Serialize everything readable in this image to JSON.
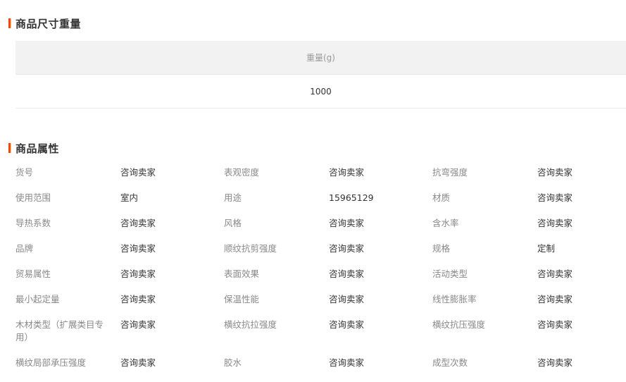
{
  "colors": {
    "accent": "#ff4400",
    "header_bg": "#f2f2f2",
    "label_text": "#888888",
    "value_text": "#333333"
  },
  "size_section": {
    "title": "商品尺寸重量",
    "column_header": "重量(g)",
    "value": "1000"
  },
  "attr_section": {
    "title": "商品属性",
    "rows": [
      [
        {
          "label": "货号",
          "value": "咨询卖家"
        },
        {
          "label": "表观密度",
          "value": "咨询卖家"
        },
        {
          "label": "抗弯强度",
          "value": "咨询卖家"
        }
      ],
      [
        {
          "label": "使用范围",
          "value": "室内"
        },
        {
          "label": "用途",
          "value": "15965129"
        },
        {
          "label": "材质",
          "value": "咨询卖家"
        }
      ],
      [
        {
          "label": "导热系数",
          "value": "咨询卖家"
        },
        {
          "label": "风格",
          "value": "咨询卖家"
        },
        {
          "label": "含水率",
          "value": "咨询卖家"
        }
      ],
      [
        {
          "label": "品牌",
          "value": "咨询卖家"
        },
        {
          "label": "顺纹抗剪强度",
          "value": "咨询卖家"
        },
        {
          "label": "规格",
          "value": "定制"
        }
      ],
      [
        {
          "label": "贸易属性",
          "value": "咨询卖家"
        },
        {
          "label": "表面效果",
          "value": "咨询卖家"
        },
        {
          "label": "活动类型",
          "value": "咨询卖家"
        }
      ],
      [
        {
          "label": "最小起定量",
          "value": "咨询卖家"
        },
        {
          "label": "保温性能",
          "value": "咨询卖家"
        },
        {
          "label": "线性膨胀率",
          "value": "咨询卖家"
        }
      ],
      [
        {
          "label": "木材类型（扩展类目专用）",
          "value": "咨询卖家"
        },
        {
          "label": "横纹抗拉强度",
          "value": "咨询卖家"
        },
        {
          "label": "横纹抗压强度",
          "value": "咨询卖家"
        }
      ],
      [
        {
          "label": "横纹局部承压强度",
          "value": "咨询卖家"
        },
        {
          "label": "胶水",
          "value": "咨询卖家"
        },
        {
          "label": "成型次数",
          "value": "咨询卖家"
        }
      ]
    ]
  }
}
